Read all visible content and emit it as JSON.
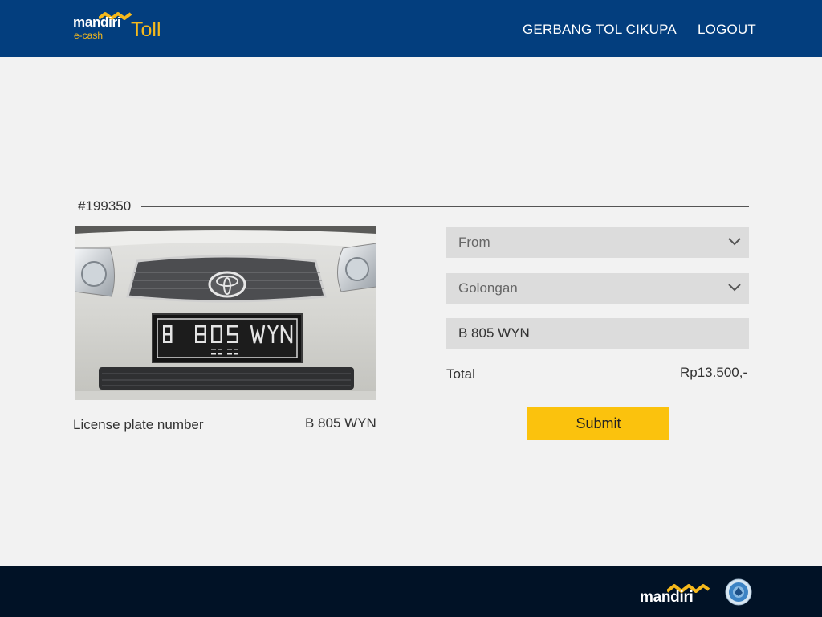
{
  "header": {
    "logo": {
      "brand": "mandiri",
      "sub": "e-cash",
      "product": "Toll"
    },
    "nav": {
      "gate": "GERBANG TOL CIKUPA",
      "logout": "LOGOUT"
    }
  },
  "transaction": {
    "id": "#199350",
    "photo_icon": "vehicle-photo",
    "plate_label": "License plate number",
    "plate_value": "B 805 WYN"
  },
  "form": {
    "from": {
      "placeholder": "From"
    },
    "golongan": {
      "placeholder": "Golongan"
    },
    "plate_input": {
      "value": "B 805 WYN"
    },
    "total_label": "Total",
    "total_value": "Rp13.500,-",
    "submit_label": "Submit"
  },
  "footer": {
    "brand": "mandiri",
    "seal_icon": "government-seal-icon"
  },
  "colors": {
    "header_bg": "#033e7e",
    "accent_yellow": "#fbc20d",
    "logo_gold": "#f6b91c",
    "footer_bg": "#011226",
    "page_bg": "#f2f2f2",
    "field_bg": "#dcdcdc"
  }
}
